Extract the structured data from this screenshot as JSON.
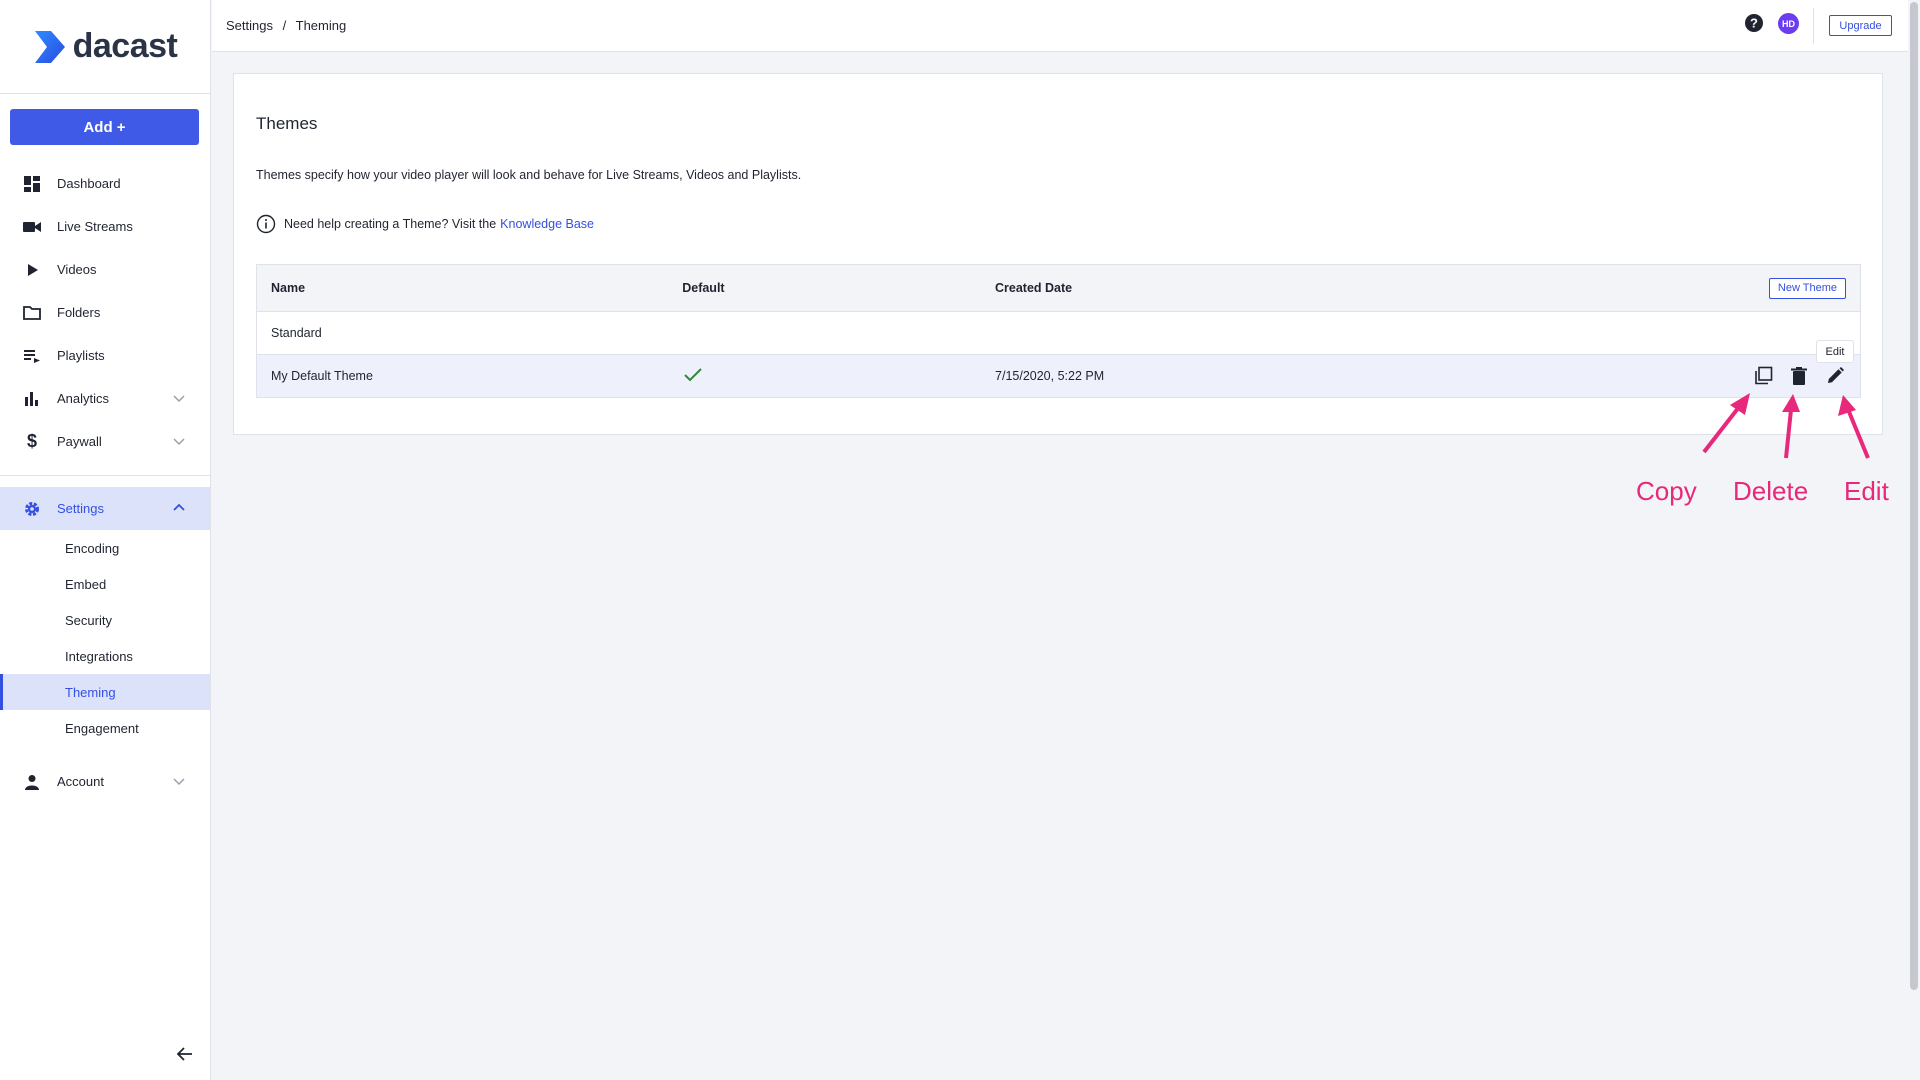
{
  "logo": {
    "text": "dacast"
  },
  "sidebar": {
    "add_label": "Add +",
    "items": [
      {
        "label": "Dashboard",
        "icon": "dashboard-icon"
      },
      {
        "label": "Live Streams",
        "icon": "video-camera-icon"
      },
      {
        "label": "Videos",
        "icon": "play-icon"
      },
      {
        "label": "Folders",
        "icon": "folder-icon"
      },
      {
        "label": "Playlists",
        "icon": "playlist-icon"
      },
      {
        "label": "Analytics",
        "icon": "bar-chart-icon"
      },
      {
        "label": "Paywall",
        "icon": "dollar-icon"
      },
      {
        "label": "Settings",
        "icon": "gear-icon"
      },
      {
        "label": "Account",
        "icon": "person-icon"
      }
    ],
    "settings_sub": [
      "Encoding",
      "Embed",
      "Security",
      "Integrations",
      "Theming",
      "Engagement"
    ]
  },
  "header": {
    "breadcrumb": [
      "Settings",
      "/",
      "Theming"
    ],
    "avatar_initials": "HD",
    "upgrade_label": "Upgrade"
  },
  "card": {
    "title": "Themes",
    "description": "Themes specify how your video player will look and behave for Live Streams, Videos and Playlists.",
    "help_text": "Need help creating a Theme? Visit the",
    "help_link": "Knowledge Base",
    "new_theme_label": "New Theme",
    "columns": [
      "Name",
      "Default",
      "Created Date"
    ],
    "rows": [
      {
        "name": "Standard",
        "default": false,
        "created": ""
      },
      {
        "name": "My Default Theme",
        "default": true,
        "created": "7/15/2020, 5:22 PM"
      }
    ],
    "tooltip": "Edit"
  },
  "annotations": {
    "copy": "Copy",
    "delete": "Delete",
    "edit": "Edit"
  },
  "colors": {
    "accent": "#3350e0",
    "annotation": "#e8287a",
    "check": "#2e8b3a"
  }
}
